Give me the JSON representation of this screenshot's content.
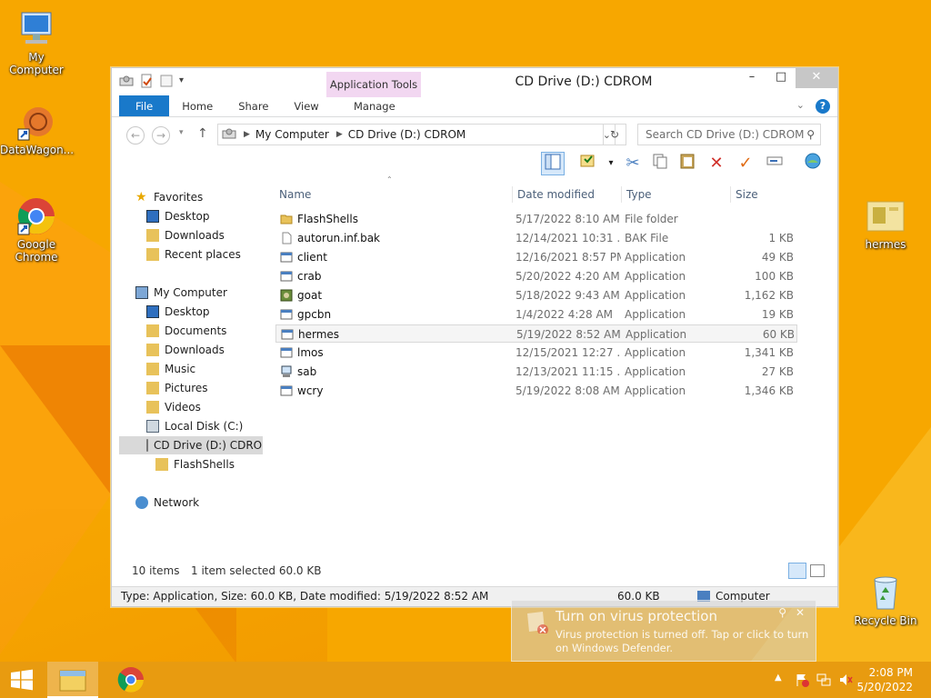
{
  "desktop": {
    "icons": [
      {
        "label": "My Computer"
      },
      {
        "label": "DataWagon..."
      },
      {
        "label": "Google Chrome"
      },
      {
        "label": "hermes"
      },
      {
        "label": "Recycle Bin"
      }
    ]
  },
  "window": {
    "title": "CD Drive (D:) CDROM",
    "context_tab_group": "Application Tools",
    "controls": {
      "minimize": "–",
      "maximize": "□",
      "close": "✕"
    },
    "ribbon_tabs": [
      "File",
      "Home",
      "Share",
      "View",
      "Manage"
    ],
    "address": {
      "crumbs": [
        "My Computer",
        "CD Drive (D:) CDROM"
      ]
    },
    "search_placeholder": "Search CD Drive (D:) CDROM",
    "nav": {
      "favorites": "Favorites",
      "fav_items": [
        "Desktop",
        "Downloads",
        "Recent places"
      ],
      "computer": "My Computer",
      "computer_items": [
        "Desktop",
        "Documents",
        "Downloads",
        "Music",
        "Pictures",
        "Videos",
        "Local Disk (C:)",
        "CD Drive (D:) CDROM"
      ],
      "sub_item": "FlashShells",
      "network": "Network"
    },
    "columns": {
      "name": "Name",
      "date": "Date modified",
      "type": "Type",
      "size": "Size"
    },
    "files": [
      {
        "name": "FlashShells",
        "date": "5/17/2022 8:10 AM",
        "type": "File folder",
        "size": "",
        "icon": "folder-icon"
      },
      {
        "name": "autorun.inf.bak",
        "date": "12/14/2021 10:31 ...",
        "type": "BAK File",
        "size": "1 KB",
        "icon": "file-icon"
      },
      {
        "name": "client",
        "date": "12/16/2021 8:57 PM",
        "type": "Application",
        "size": "49 KB",
        "icon": "app-icon"
      },
      {
        "name": "crab",
        "date": "5/20/2022 4:20 AM",
        "type": "Application",
        "size": "100 KB",
        "icon": "app-icon"
      },
      {
        "name": "goat",
        "date": "5/18/2022 9:43 AM",
        "type": "Application",
        "size": "1,162 KB",
        "icon": "goat-app-icon"
      },
      {
        "name": "gpcbn",
        "date": "1/4/2022 4:28 AM",
        "type": "Application",
        "size": "19 KB",
        "icon": "app-icon"
      },
      {
        "name": "hermes",
        "date": "5/19/2022 8:52 AM",
        "type": "Application",
        "size": "60 KB",
        "icon": "app-icon",
        "selected": true
      },
      {
        "name": "lmos",
        "date": "12/15/2021 12:27 ...",
        "type": "Application",
        "size": "1,341 KB",
        "icon": "app-icon"
      },
      {
        "name": "sab",
        "date": "12/13/2021 11:15 ...",
        "type": "Application",
        "size": "27 KB",
        "icon": "computer-app-icon"
      },
      {
        "name": "wcry",
        "date": "5/19/2022 8:08 AM",
        "type": "Application",
        "size": "1,346 KB",
        "icon": "app-icon"
      }
    ],
    "status": {
      "count": "10 items",
      "selection": "1 item selected  60.0 KB"
    },
    "details": {
      "info": "Type: Application, Size: 60.0 KB, Date modified: 5/19/2022 8:52 AM",
      "size": "60.0 KB",
      "location": "Computer"
    }
  },
  "toast": {
    "title": "Turn on virus protection",
    "message": "Virus protection is turned off. Tap or click to turn on Windows Defender."
  },
  "taskbar": {
    "time": "2:08 PM",
    "date": "5/20/2022"
  },
  "colors": {
    "accent": "#1979ca",
    "desktop": "#f7a700",
    "taskbar": "#e89b10"
  }
}
